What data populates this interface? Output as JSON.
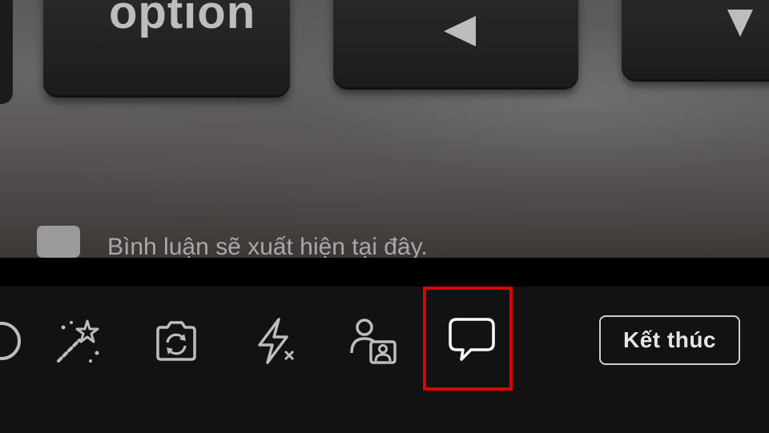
{
  "preview": {
    "keyboard": {
      "option_key_label": "option"
    },
    "comment_hint": {
      "icon": "speech-bubble-icon",
      "text": "Bình luận sẽ xuất hiện tại đây."
    }
  },
  "toolbar": {
    "icons": [
      "magic-wand-icon",
      "camera-flip-icon",
      "flash-off-icon",
      "add-guest-icon",
      "comment-icon"
    ],
    "highlight_color": "#e00000",
    "end_button_label": "Kết thúc"
  }
}
